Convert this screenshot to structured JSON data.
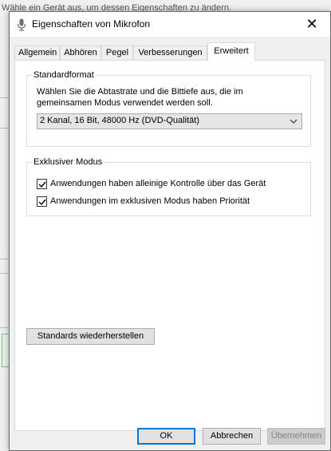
{
  "background": {
    "title_fragment": "Wähle ein Gerät aus, um dessen Eigenschaften zu ändern."
  },
  "dialog": {
    "title": "Eigenschaften von Mikrofon",
    "close_glyph": "✕",
    "tabs": [
      {
        "label": "Allgemein",
        "active": false
      },
      {
        "label": "Abhören",
        "active": false
      },
      {
        "label": "Pegel",
        "active": false
      },
      {
        "label": "Verbesserungen",
        "active": false
      },
      {
        "label": "Erweitert",
        "active": true
      }
    ],
    "standard_format": {
      "legend": "Standardformat",
      "description": "Wählen Sie die Abtastrate und die Bittiefe aus, die im gemeinsamen Modus verwendet werden soll.",
      "selected": "2 Kanal, 16 Bit, 48000 Hz (DVD-Qualität)"
    },
    "exclusive_mode": {
      "legend": "Exklusiver Modus",
      "options": [
        {
          "label": "Anwendungen haben alleinige Kontrolle über das Gerät",
          "checked": true
        },
        {
          "label": "Anwendungen im exklusiven Modus haben Priorität",
          "checked": true
        }
      ]
    },
    "restore_defaults_label": "Standards wiederherstellen",
    "buttons": {
      "ok": "OK",
      "cancel": "Abbrechen",
      "apply": "Übernehmen"
    }
  },
  "colors": {
    "focus_border": "#0078d7",
    "panel_bg": "#ffffff",
    "dialog_bg": "#f0f0f0"
  },
  "icons": {
    "title_icon": "microphone-icon",
    "dropdown_icon": "chevron-down-icon",
    "check_icon": "checkmark-icon"
  }
}
